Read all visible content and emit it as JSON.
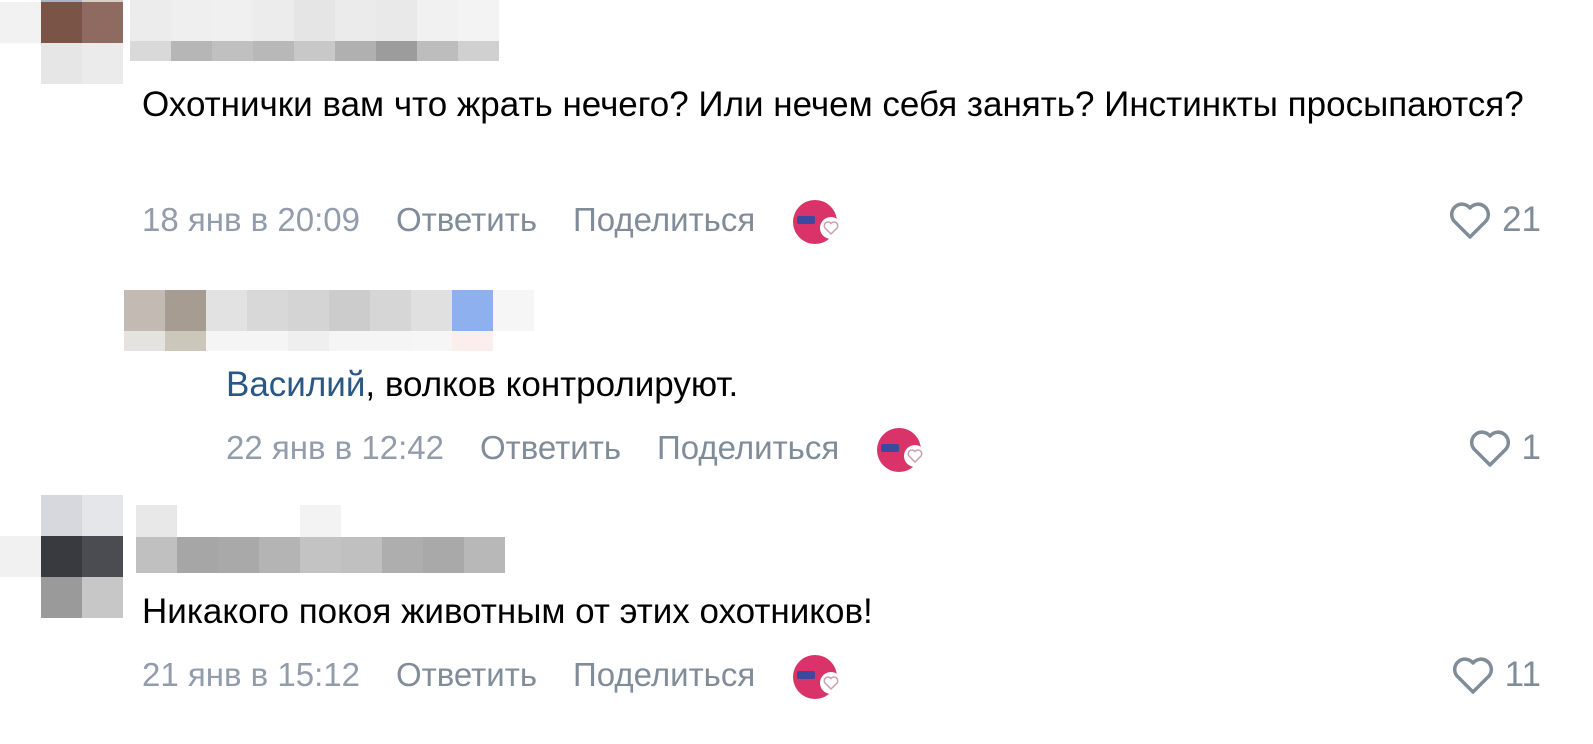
{
  "comments": [
    {
      "text": "Охотнички вам что жрать нечего? Или нечем себя занять? Инстинкты просыпаются?",
      "date": "18 янв в 20:09",
      "reply_label": "Ответить",
      "share_label": "Поделиться",
      "likes": "21",
      "reaction_icon": "sticker-reaction-icon",
      "like_icon": "heart-icon"
    },
    {
      "mention": "Василий",
      "text": ", волков контролируют.",
      "date": "22 янв в 12:42",
      "reply_label": "Ответить",
      "share_label": "Поделиться",
      "likes": "1",
      "reaction_icon": "sticker-reaction-icon",
      "like_icon": "heart-icon"
    },
    {
      "text": "Никакого покоя животным от этих охотников!",
      "date": "21 янв в 15:12",
      "reply_label": "Ответить",
      "share_label": "Поделиться",
      "likes": "11",
      "reaction_icon": "sticker-reaction-icon",
      "like_icon": "heart-icon"
    }
  ],
  "colors": {
    "text": "#000000",
    "meta": "#939cab",
    "action": "#818c99",
    "mention": "#2a5885",
    "reaction_pink": "#d9336a",
    "reaction_blue": "#3b4a9e"
  }
}
